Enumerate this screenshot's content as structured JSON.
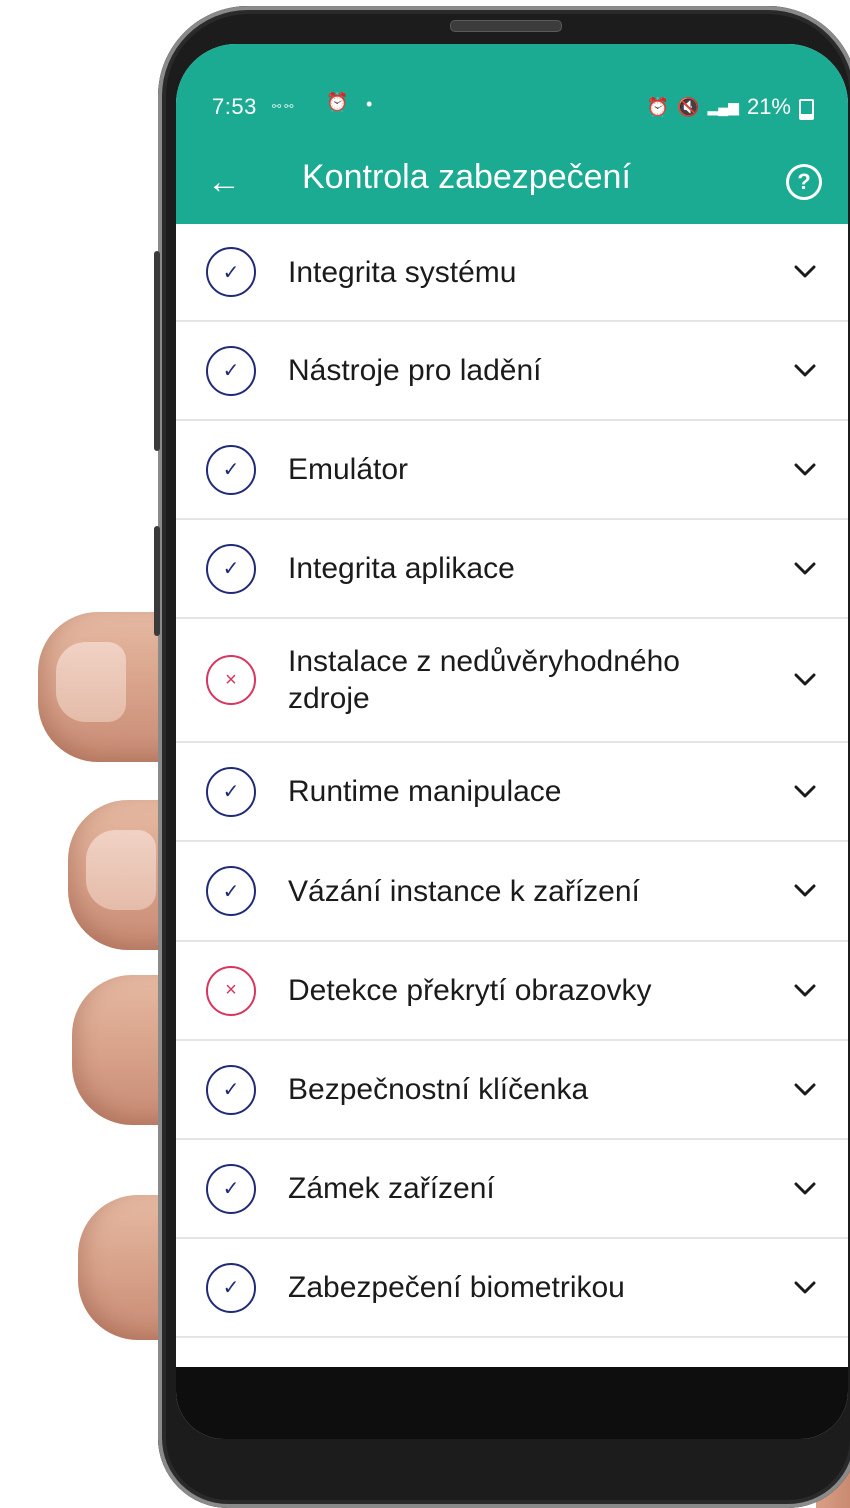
{
  "status_bar": {
    "time": "7:53",
    "notif_mini": "⚯ ⚯",
    "battery_pct": "21%"
  },
  "toolbar": {
    "back_icon": "arrow-left-icon",
    "back_glyph": "←",
    "title": "Kontrola zabezpečení",
    "help_glyph": "?"
  },
  "checks": [
    {
      "label": "Integrita systému",
      "status": "ok"
    },
    {
      "label": "Nástroje pro ladění",
      "status": "ok"
    },
    {
      "label": "Emulátor",
      "status": "ok"
    },
    {
      "label": "Integrita aplikace",
      "status": "ok"
    },
    {
      "label": "Instalace z nedůvěryhodného zdroje",
      "status": "fail"
    },
    {
      "label": "Runtime manipulace",
      "status": "ok"
    },
    {
      "label": "Vázání instance k zařízení",
      "status": "ok"
    },
    {
      "label": "Detekce překrytí obrazovky",
      "status": "fail"
    },
    {
      "label": "Bezpečnostní klíčenka",
      "status": "ok"
    },
    {
      "label": "Zámek zařízení",
      "status": "ok"
    },
    {
      "label": "Zabezpečení biometrikou",
      "status": "ok"
    }
  ],
  "glyphs": {
    "ok": "✓",
    "fail": "×"
  },
  "colors": {
    "app_bar": "#1bab92",
    "ok_icon": "#222a78",
    "fail_icon": "#d8355f"
  }
}
